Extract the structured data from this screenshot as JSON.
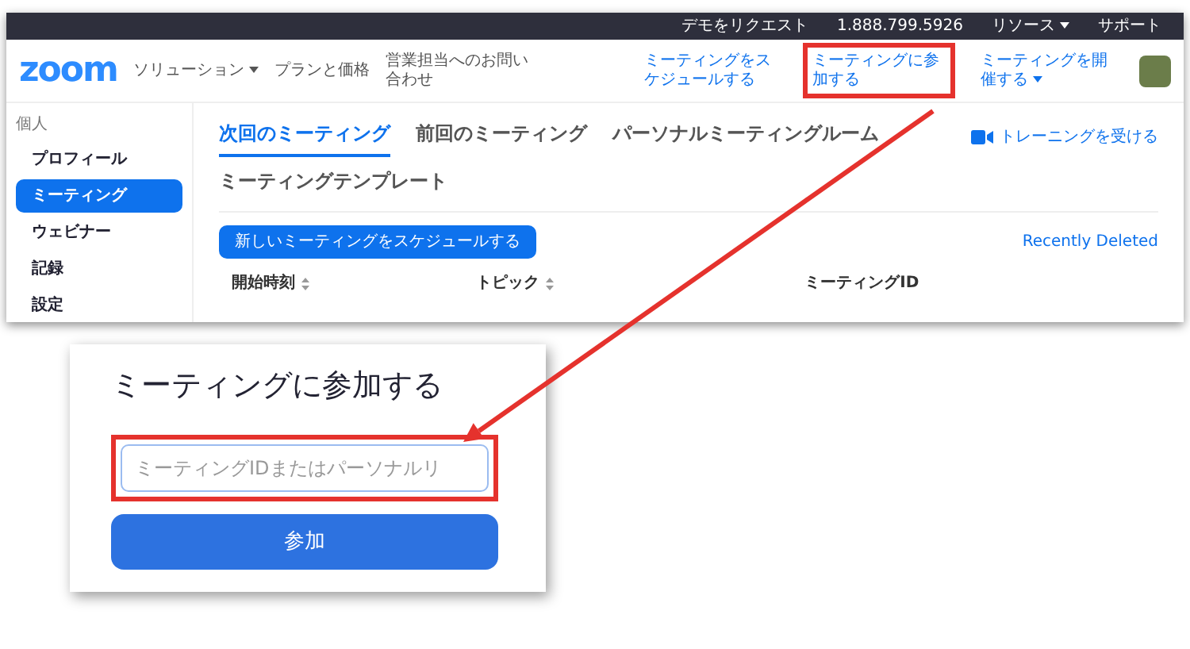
{
  "top_bar": {
    "items": [
      {
        "label": "デモをリクエスト",
        "dropdown": false
      },
      {
        "label": "1.888.799.5926",
        "dropdown": false
      },
      {
        "label": "リソース",
        "dropdown": true
      },
      {
        "label": "サポート",
        "dropdown": false
      }
    ]
  },
  "navbar": {
    "logo": "zoom",
    "left_links": [
      {
        "label": "ソリューション",
        "dropdown": true
      },
      {
        "label": "プランと価格",
        "dropdown": false
      },
      {
        "label": "営業担当へのお問い合わせ",
        "dropdown": false
      }
    ],
    "right_links": [
      {
        "label": "ミーティングをスケジュールする",
        "dropdown": false,
        "highlighted": false
      },
      {
        "label": "ミーティングに参加する",
        "dropdown": false,
        "highlighted": true
      },
      {
        "label": "ミーティングを開催する",
        "dropdown": true,
        "highlighted": false
      }
    ]
  },
  "sidebar": {
    "section": "個人",
    "items": [
      {
        "label": "プロフィール",
        "selected": false
      },
      {
        "label": "ミーティング",
        "selected": true
      },
      {
        "label": "ウェビナー",
        "selected": false
      },
      {
        "label": "記録",
        "selected": false
      },
      {
        "label": "設定",
        "selected": false
      }
    ]
  },
  "tabs": [
    {
      "label": "次回のミーティング",
      "selected": true
    },
    {
      "label": "前回のミーティング",
      "selected": false
    },
    {
      "label": "パーソナルミーティングルーム",
      "selected": false
    },
    {
      "label": "ミーティングテンプレート",
      "selected": false
    }
  ],
  "training_link": "トレーニングを受ける",
  "schedule_button": "新しいミーティングをスケジュールする",
  "recently_deleted": "Recently Deleted",
  "table": {
    "columns": [
      {
        "label": "開始時刻",
        "sortable": true
      },
      {
        "label": "トピック",
        "sortable": true
      },
      {
        "label": "ミーティングID",
        "sortable": false
      }
    ]
  },
  "join_panel": {
    "title": "ミーティングに参加する",
    "placeholder": "ミーティングIDまたはパーソナルリ",
    "highlighted": true,
    "button": "参加"
  }
}
